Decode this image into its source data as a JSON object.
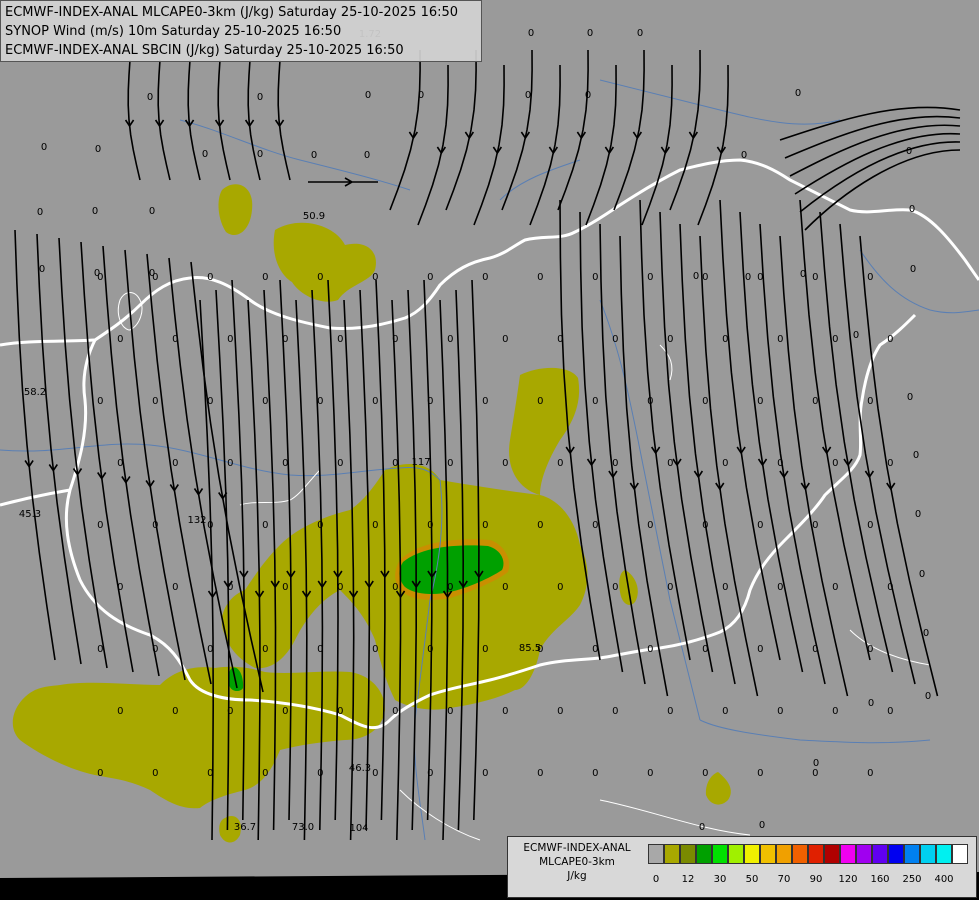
{
  "title_lines": [
    "ECMWF-INDEX-ANAL MLCAPE0-3km (J/kg) Saturday 25-10-2025 16:50",
    "SYNOP Wind (m/s) 10m Saturday 25-10-2025 16:50",
    "ECMWF-INDEX-ANAL SBCIN (J/kg) Saturday 25-10-2025 16:50"
  ],
  "legend": {
    "title_lines": [
      "ECMWF-INDEX-ANAL",
      "MLCAPE0-3km",
      "J/kg"
    ],
    "colors": [
      "#a8a8a8",
      "#a8a800",
      "#7a8a00",
      "#00a000",
      "#00e000",
      "#a0f000",
      "#f0f000",
      "#f0c000",
      "#f0a000",
      "#f06000",
      "#e02000",
      "#b00000",
      "#f000f0",
      "#a000f0",
      "#6000f0",
      "#0000f0",
      "#0080f0",
      "#00d0f0",
      "#00f0f0",
      "#ffffff"
    ],
    "ticks": [
      "0",
      "12",
      "30",
      "50",
      "70",
      "90",
      "120",
      "160",
      "250",
      "400"
    ]
  },
  "map_colors": {
    "background": "#9a9a9a",
    "cape_low": "#a8a800",
    "cape_high": "#00a000",
    "border": "#ffffff",
    "river": "#5a7fb4",
    "streamline": "#000000"
  },
  "cin_values": [
    {
      "v": "0"
    },
    {
      "v": "0"
    },
    {
      "v": "0"
    },
    {
      "v": "0"
    },
    {
      "v": "0"
    },
    {
      "v": "0"
    },
    {
      "v": "0"
    },
    {
      "v": "0"
    },
    {
      "v": "0"
    },
    {
      "v": "0"
    },
    {
      "v": "0"
    },
    {
      "v": "0"
    },
    {
      "v": "0"
    },
    {
      "v": "0"
    },
    {
      "v": "0"
    },
    {
      "v": "0"
    },
    {
      "v": "0"
    },
    {
      "v": "0"
    },
    {
      "v": "0"
    },
    {
      "v": "0"
    },
    {
      "v": "0"
    },
    {
      "v": "0"
    },
    {
      "v": "0"
    },
    {
      "v": "0"
    },
    {
      "v": "0"
    },
    {
      "v": "0"
    },
    {
      "v": "0"
    },
    {
      "v": "0"
    },
    {
      "v": "0"
    },
    {
      "v": "0"
    },
    {
      "v": "0"
    },
    {
      "v": "0"
    },
    {
      "v": "0"
    },
    {
      "v": "0"
    },
    {
      "v": "0"
    },
    {
      "v": "0"
    },
    {
      "v": "0"
    },
    {
      "v": "0"
    },
    {
      "v": "0"
    },
    {
      "v": "0"
    },
    {
      "v": "1.72"
    },
    {
      "v": "50.9"
    },
    {
      "v": "58.2"
    },
    {
      "v": "45.3"
    },
    {
      "v": "132"
    },
    {
      "v": "117"
    },
    {
      "v": "85.5"
    },
    {
      "v": "46.3"
    },
    {
      "v": "36.7"
    },
    {
      "v": "73.0"
    },
    {
      "v": "104"
    }
  ]
}
